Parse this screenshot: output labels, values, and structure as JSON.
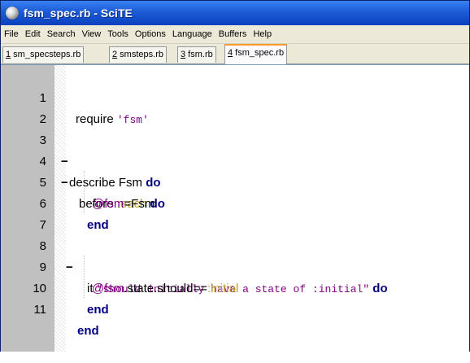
{
  "window": {
    "title": "fsm_spec.rb - SciTE",
    "icon": "scite-app-icon"
  },
  "menu": [
    "File",
    "Edit",
    "Search",
    "View",
    "Tools",
    "Options",
    "Language",
    "Buffers",
    "Help"
  ],
  "tabs": [
    {
      "num": "1",
      "label": " sm_specsteps.rb",
      "active": false
    },
    {
      "num": "2",
      "label": " smsteps.rb",
      "active": false
    },
    {
      "num": "3",
      "label": " fsm.rb",
      "active": false
    },
    {
      "num": "4",
      "label": " fsm_spec.rb",
      "active": true
    }
  ],
  "editor": {
    "line_numbers": [
      "1",
      "2",
      "3",
      "4",
      "5",
      "6",
      "7",
      "8",
      "9",
      "10",
      "11"
    ],
    "fold_markers": [
      "",
      "",
      "−",
      "−",
      "",
      "",
      "",
      "−",
      "",
      "",
      ""
    ],
    "lines": {
      "l1": {
        "plain": "require ",
        "str": "'fsm'"
      },
      "l3": {
        "plain": "describe Fsm ",
        "kw": "do"
      },
      "l4": {
        "plain": "before ",
        "sym": ":each",
        "kw": " do"
      },
      "l5": {
        "ivar": "@fsm",
        "plain": "=Fsm"
      },
      "l6": {
        "kw": "end"
      },
      "l8": {
        "plain": "it ",
        "str": "\"should initially have a state of :initial\"",
        "kw": " do"
      },
      "l9": {
        "ivar": "@fsm",
        "plain": ".state.should==",
        "sym": ":initial"
      },
      "l10": {
        "kw": "end"
      },
      "l11": {
        "kw": "end"
      }
    }
  }
}
